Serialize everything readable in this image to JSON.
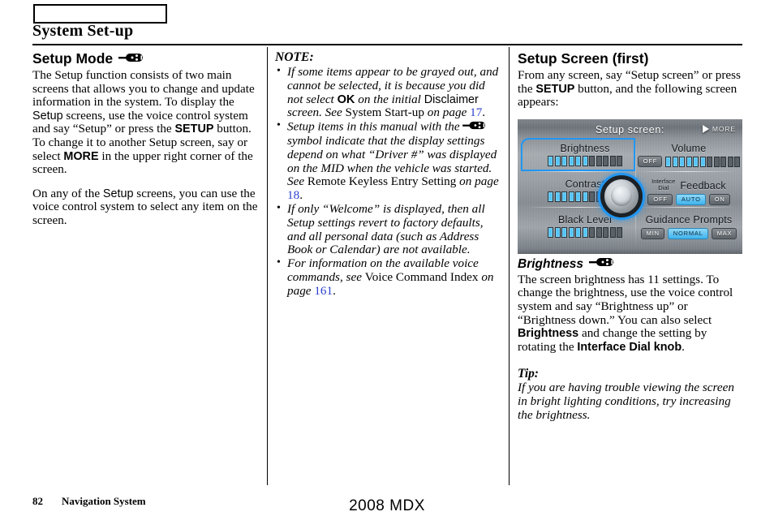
{
  "header": {
    "tab_label": "",
    "title": "System Set-up"
  },
  "col1": {
    "heading": "Setup Mode",
    "fob_icon": "key-fob-icon",
    "p1_a": "The Setup function consists of two main screens that allows you to change and update information in the system. To display the ",
    "p1_setup": "Setup",
    "p1_b": " screens, use the voice control system and say “Setup” or press the ",
    "p1_setupbtn": "SETUP",
    "p1_c": " button. To change it to another Setup screen, say or select ",
    "p1_more": "MORE",
    "p1_d": " in the upper right corner of the screen.",
    "p2_a": "On any of the ",
    "p2_setup": "Setup",
    "p2_b": " screens, you can use the voice control system to select any item on the screen."
  },
  "col2": {
    "note_head": "NOTE:",
    "n1_a": "If some items appear to be grayed out, and cannot be selected, it is because you did not select ",
    "n1_ok": "OK",
    "n1_b": " on the initial ",
    "n1_disc": "Disclaimer",
    "n1_c": " screen. See ",
    "n1_sys": "System Start-up",
    "n1_d": " on page ",
    "n1_page": "17",
    "n1_e": ".",
    "n2_a": "Setup items in this manual with the ",
    "n2_icon": "key-fob-icon",
    "n2_b": " symbol indicate that the display settings depend on what “Driver #” was displayed on the MID when the vehicle was started. See ",
    "n2_rke": "Remote Keyless Entry Setting",
    "n2_c": " on page ",
    "n2_page": "18",
    "n2_d": ".",
    "n3": "If only “Welcome” is displayed, then all Setup settings revert to factory defaults, and all personal data (such as Address Book or Calendar) are not available.",
    "n4_a": "For information on the available voice commands, see ",
    "n4_vci": "Voice Command Index",
    "n4_b": " on page ",
    "n4_page": "161",
    "n4_c": "."
  },
  "col3": {
    "heading": "Setup Screen (first)",
    "intro_a": "From any screen, say “Setup screen” or press the ",
    "intro_setup": "SETUP",
    "intro_b": " button, and the following screen appears:",
    "brightness_heading": "Brightness",
    "fob_icon": "key-fob-icon",
    "b_a": "The screen brightness has 11 settings. To change the brightness, use the voice control system and say “Brightness up” or “Brightness down.” You can also select ",
    "b_bright": "Brightness",
    "b_b": " and change the setting by rotating the ",
    "b_dial": "Interface Dial knob",
    "b_c": ".",
    "tip_head": "Tip:",
    "tip_body": "If you are having trouble viewing the screen in bright lighting conditions, try increasing the brightness."
  },
  "navscreen": {
    "title": "Setup screen:",
    "more_label": "MORE",
    "more_icon": "play-triangle-icon",
    "selected_item": "Brightness",
    "cells": {
      "brightness": {
        "label": "Brightness",
        "segments_total": 11,
        "segments_on": 6
      },
      "volume": {
        "label": "Volume",
        "off_label": "OFF",
        "segments_total": 11,
        "segments_on": 6
      },
      "contrast": {
        "label": "Contrast",
        "segments_total": 11,
        "segments_on": 6
      },
      "black_level": {
        "label": "Black Level",
        "segments_total": 11,
        "segments_on": 6
      },
      "interface_dial": {
        "label_line1": "Interface",
        "label_line2": "Dial"
      },
      "feedback": {
        "label": "Feedback",
        "options": [
          "OFF",
          "AUTO",
          "ON"
        ],
        "selected": "AUTO"
      },
      "guidance": {
        "label": "Guidance Prompts",
        "options": [
          "MIN",
          "NORMAL",
          "MAX"
        ],
        "selected": "NORMAL"
      }
    },
    "knob_icon": "interface-dial-knob-icon",
    "colors": {
      "accent": "#4fc3f7",
      "highlight": "#2196f3",
      "bezel": "#8e949a"
    }
  },
  "footer": {
    "page_number": "82",
    "section": "Navigation System",
    "model": "2008  MDX"
  }
}
